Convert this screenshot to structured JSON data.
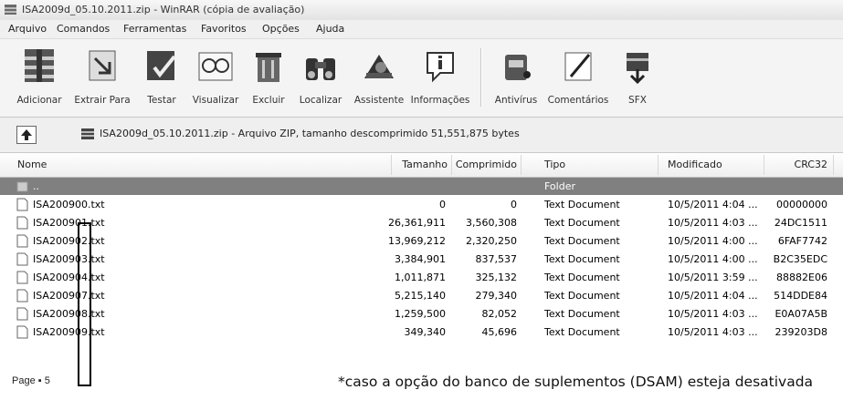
{
  "window": {
    "title": "ISA2009d_05.10.2011.zip - WinRAR (cópia de avaliação)"
  },
  "menu": [
    {
      "label": "Arquivo"
    },
    {
      "label": "Comandos"
    },
    {
      "label": "Ferramentas"
    },
    {
      "label": "Favoritos"
    },
    {
      "label": "Opções"
    },
    {
      "label": "Ajuda"
    }
  ],
  "toolbar": [
    {
      "label": "Adicionar",
      "icon": "add-archive-icon"
    },
    {
      "label": "Extrair Para",
      "icon": "extract-to-icon"
    },
    {
      "label": "Testar",
      "icon": "test-icon"
    },
    {
      "label": "Visualizar",
      "icon": "view-icon"
    },
    {
      "label": "Excluir",
      "icon": "delete-icon"
    },
    {
      "label": "Localizar",
      "icon": "find-icon"
    },
    {
      "label": "Assistente",
      "icon": "wizard-icon"
    },
    {
      "label": "Informações",
      "icon": "info-icon"
    },
    {
      "label": "Antivírus",
      "icon": "antivirus-icon"
    },
    {
      "label": "Comentários",
      "icon": "comment-icon"
    },
    {
      "label": "SFX",
      "icon": "sfx-icon"
    }
  ],
  "address": {
    "text": "ISA2009d_05.10.2011.zip - Arquivo ZIP, tamanho descomprimido 51,551,875 bytes"
  },
  "columns": {
    "name": "Nome",
    "size": "Tamanho",
    "packed": "Comprimido",
    "type": "Tipo",
    "modified": "Modificado",
    "crc": "CRC32"
  },
  "parent_row": {
    "name": "..",
    "type": "Folder"
  },
  "files": [
    {
      "name": "ISA200900.txt",
      "size": "0",
      "packed": "0",
      "type": "Text Document",
      "modified": "10/5/2011 4:04 ...",
      "crc": "00000000"
    },
    {
      "name": "ISA200901.txt",
      "size": "26,361,911",
      "packed": "3,560,308",
      "type": "Text Document",
      "modified": "10/5/2011 4:03 ...",
      "crc": "24DC1511"
    },
    {
      "name": "ISA200902.txt",
      "size": "13,969,212",
      "packed": "2,320,250",
      "type": "Text Document",
      "modified": "10/5/2011 4:00 ...",
      "crc": "6FAF7742"
    },
    {
      "name": "ISA200903.txt",
      "size": "3,384,901",
      "packed": "837,537",
      "type": "Text Document",
      "modified": "10/5/2011 4:00 ...",
      "crc": "B2C35EDC"
    },
    {
      "name": "ISA200904.txt",
      "size": "1,011,871",
      "packed": "325,132",
      "type": "Text Document",
      "modified": "10/5/2011 3:59 ...",
      "crc": "88882E06"
    },
    {
      "name": "ISA200907.txt",
      "size": "5,215,140",
      "packed": "279,340",
      "type": "Text Document",
      "modified": "10/5/2011 4:04 ...",
      "crc": "514DDE84"
    },
    {
      "name": "ISA200908.txt",
      "size": "1,259,500",
      "packed": "82,052",
      "type": "Text Document",
      "modified": "10/5/2011 4:03 ...",
      "crc": "E0A07A5B"
    },
    {
      "name": "ISA200909.txt",
      "size": "349,340",
      "packed": "45,696",
      "type": "Text Document",
      "modified": "10/5/2011 4:03 ...",
      "crc": "239203D8"
    }
  ],
  "footer": {
    "page": "Page ▪ 5",
    "note": "*caso a opção do banco de suplementos (DSAM) esteja desativada"
  },
  "colors": {
    "selection": "#808080",
    "highlight_box": "#000000"
  }
}
